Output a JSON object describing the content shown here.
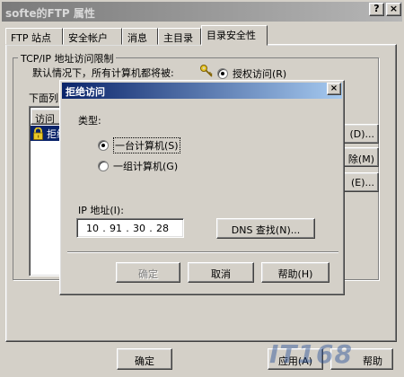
{
  "main_window": {
    "title": "softe的FTP 属性",
    "title_buttons": {
      "help": "?",
      "close": "×"
    },
    "tabs": [
      {
        "label": "FTP 站点"
      },
      {
        "label": "安全帐户"
      },
      {
        "label": "消息"
      },
      {
        "label": "主目录"
      },
      {
        "label": "目录安全性",
        "active": true
      }
    ],
    "group_label": "TCP/IP 地址访问限制",
    "default_text": "默认情况下，所有计算机都将被:",
    "grant_radio": "授权访问(R)",
    "list_label": "下面列",
    "list_header": "访问",
    "list_row": "拒绝",
    "side_buttons": [
      "(D)...",
      "除(M)",
      "(E)..."
    ],
    "bottom_buttons": {
      "ok": "确定",
      "apply": "应用(A)",
      "help": "帮助"
    },
    "watermark": "IT168"
  },
  "deny_dialog": {
    "title": "拒绝访问",
    "close": "×",
    "type_label": "类型:",
    "radio_single": "一台计算机(S)",
    "radio_group": "一组计算机(G)",
    "ip_label": "IP 地址(I):",
    "ip": [
      "10",
      "91",
      "30",
      "28"
    ],
    "dns_button": "DNS 查找(N)...",
    "ok_button": "确定",
    "cancel_button": "取消",
    "help_button": "帮助(H)"
  }
}
